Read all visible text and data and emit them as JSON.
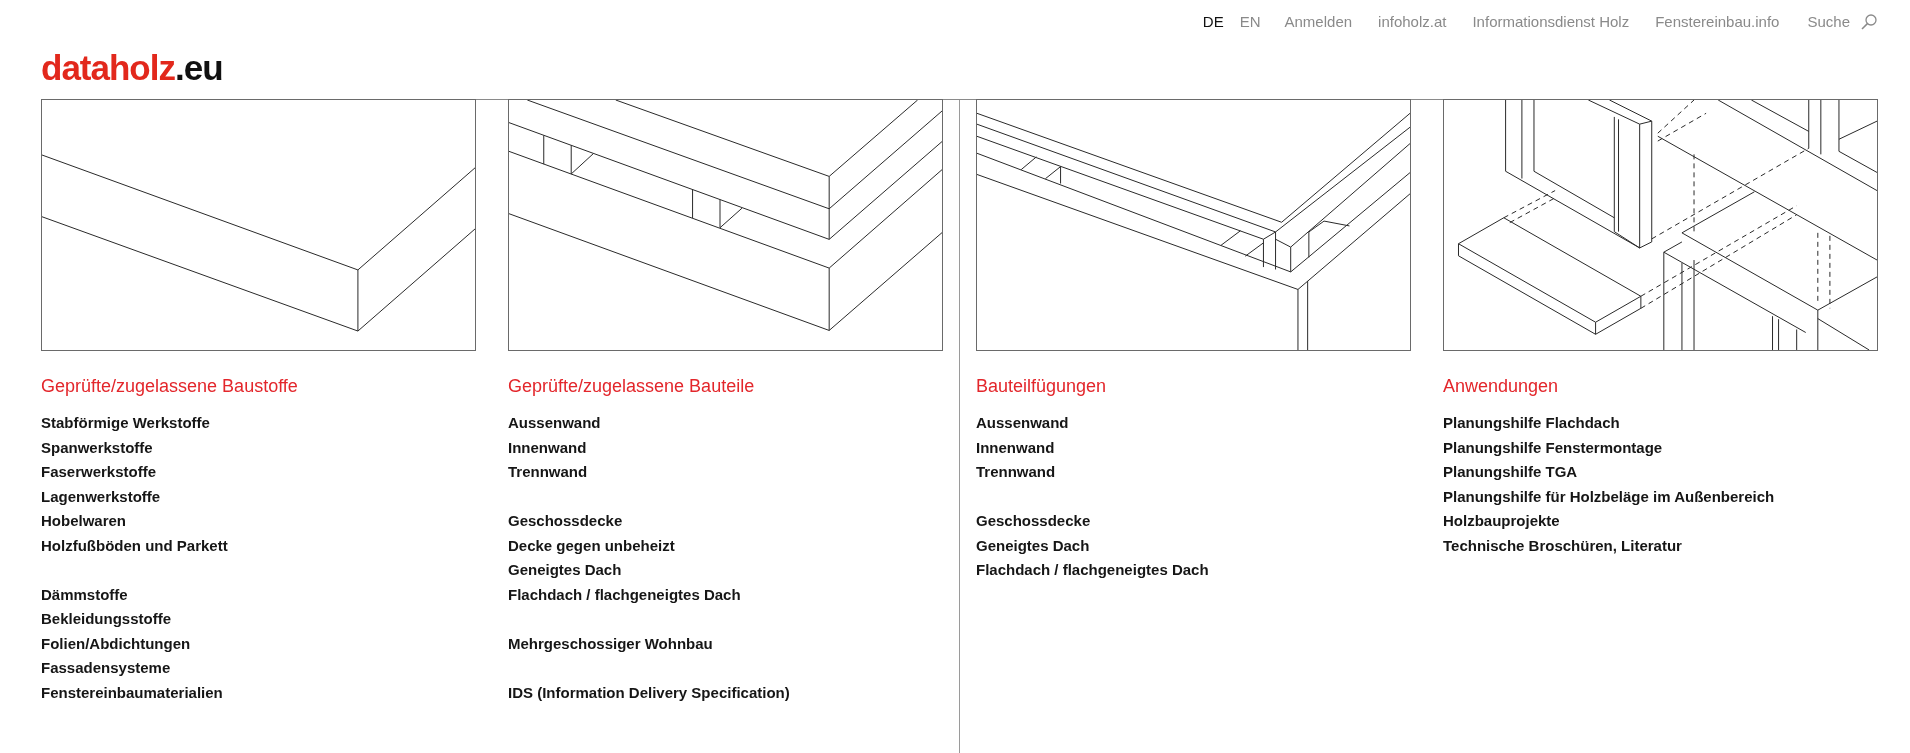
{
  "nav": {
    "languages": [
      {
        "label": "DE",
        "selected": true
      },
      {
        "label": "EN",
        "selected": false
      }
    ],
    "links": [
      "Anmelden",
      "infoholz.at",
      "Informationsdienst Holz",
      "Fenstereinbau.info"
    ],
    "search": {
      "label": "Suche"
    }
  },
  "logo": {
    "main": "dataholz",
    "suffix": ".eu"
  },
  "columns": [
    {
      "heading": "Geprüfte/zugelassene Baustoffe",
      "groups": [
        [
          "Stabförmige Werkstoffe",
          "Spanwerkstoffe",
          "Faserwerkstoffe",
          "Lagenwerkstoffe",
          "Hobelwaren",
          "Holzfußböden und Parkett"
        ],
        [
          "Dämmstoffe",
          "Bekleidungsstoffe",
          "Folien/Abdichtungen",
          "Fassadensysteme",
          "Fenstereinbaumaterialien"
        ]
      ]
    },
    {
      "heading": "Geprüfte/zugelassene Bauteile",
      "groups": [
        [
          "Aussenwand",
          "Innenwand",
          "Trennwand"
        ],
        [
          "Geschossdecke",
          "Decke gegen unbeheizt",
          "Geneigtes Dach",
          "Flachdach / flachgeneigtes Dach"
        ],
        [
          "Mehrgeschossiger Wohnbau"
        ],
        [
          "IDS (Information Delivery Specification)"
        ]
      ]
    },
    {
      "heading": "Bauteilfügungen",
      "groups": [
        [
          "Aussenwand",
          "Innenwand",
          "Trennwand"
        ],
        [
          "Geschossdecke",
          "Geneigtes Dach",
          "Flachdach / flachgeneigtes Dach"
        ]
      ]
    },
    {
      "heading": "Anwendungen",
      "groups": [
        [
          "Planungshilfe Flachdach",
          "Planungshilfe Fenstermontage",
          "Planungshilfe TGA",
          "Planungshilfe für Holzbeläge im Außenbereich",
          "Holzbauprojekte",
          "Technische Broschüren, Literatur"
        ]
      ]
    }
  ]
}
